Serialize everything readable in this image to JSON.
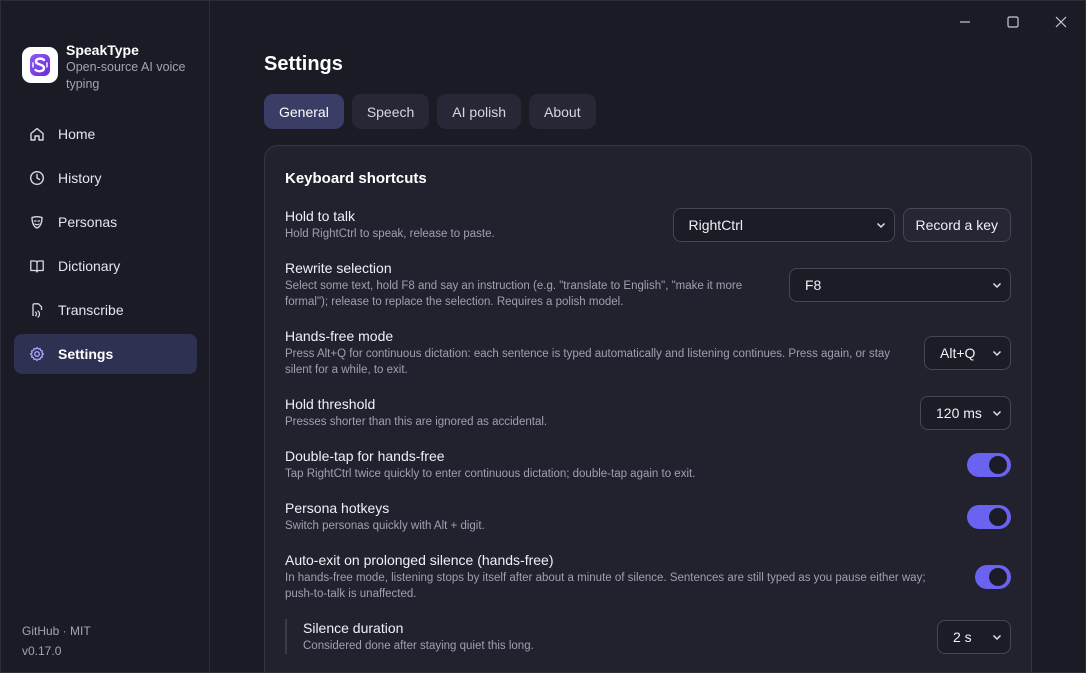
{
  "app": {
    "name": "SpeakType",
    "tagline": "Open-source AI voice typing",
    "footer_links": "GitHub · MIT",
    "version": "v0.17.0"
  },
  "sidebar": {
    "items": [
      {
        "label": "Home",
        "icon": "home-icon"
      },
      {
        "label": "History",
        "icon": "clock-icon"
      },
      {
        "label": "Personas",
        "icon": "persona-mask-icon"
      },
      {
        "label": "Dictionary",
        "icon": "book-icon"
      },
      {
        "label": "Transcribe",
        "icon": "transcribe-file-icon"
      },
      {
        "label": "Settings",
        "icon": "gear-icon",
        "active": true
      }
    ]
  },
  "window_controls": [
    "minimize-icon",
    "maximize-icon",
    "close-icon"
  ],
  "page": {
    "title": "Settings",
    "tabs": [
      {
        "label": "General",
        "active": true
      },
      {
        "label": "Speech"
      },
      {
        "label": "AI polish"
      },
      {
        "label": "About"
      }
    ]
  },
  "section": {
    "title": "Keyboard shortcuts",
    "rows": {
      "hold_to_talk": {
        "label": "Hold to talk",
        "desc": "Hold RightCtrl to speak, release to paste.",
        "value": "RightCtrl",
        "button": "Record a key"
      },
      "rewrite_selection": {
        "label": "Rewrite selection",
        "desc": "Select some text, hold F8 and say an instruction (e.g. \"translate to English\", \"make it more formal\"); release to replace the selection. Requires a polish model.",
        "value": "F8"
      },
      "hands_free": {
        "label": "Hands-free mode",
        "desc": "Press Alt+Q for continuous dictation: each sentence is typed automatically and listening continues. Press again, or stay silent for a while, to exit.",
        "value": "Alt+Q"
      },
      "hold_threshold": {
        "label": "Hold threshold",
        "desc": "Presses shorter than this are ignored as accidental.",
        "value": "120 ms"
      },
      "double_tap": {
        "label": "Double-tap for hands-free",
        "desc": "Tap RightCtrl twice quickly to enter continuous dictation; double-tap again to exit.",
        "enabled": true
      },
      "persona_hotkeys": {
        "label": "Persona hotkeys",
        "desc": "Switch personas quickly with Alt + digit.",
        "enabled": true
      },
      "auto_exit": {
        "label": "Auto-exit on prolonged silence (hands-free)",
        "desc": "In hands-free mode, listening stops by itself after about a minute of silence. Sentences are still typed as you pause either way; push-to-talk is unaffected.",
        "enabled": true
      },
      "silence_duration": {
        "label": "Silence duration",
        "desc": "Considered done after staying quiet this long.",
        "value": "2 s"
      }
    }
  },
  "colors": {
    "accent": "#6a62f0",
    "active_nav": "#2f3152",
    "background": "#1a1b25",
    "card": "#21222e"
  }
}
